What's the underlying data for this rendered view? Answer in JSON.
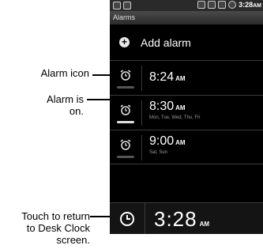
{
  "callouts": {
    "alarm_icon": "Alarm icon",
    "alarm_on_line1": "Alarm is",
    "alarm_on_line2": "on.",
    "touch_line1": "Touch to return",
    "touch_line2": "to Desk Clock",
    "touch_line3": "screen."
  },
  "status_bar": {
    "time": "3:28",
    "ampm": "AM"
  },
  "app": {
    "title": "Alarms"
  },
  "add_alarm": {
    "label": "Add alarm",
    "icon": "add-icon"
  },
  "alarms": [
    {
      "time": "8:24",
      "ampm": "AM",
      "days": "",
      "on": false
    },
    {
      "time": "8:30",
      "ampm": "AM",
      "days": "Mon, Tue, Wed, Thu, Fri",
      "on": true
    },
    {
      "time": "9:00",
      "ampm": "AM",
      "days": "Sat, Sun",
      "on": false
    }
  ],
  "desk_clock": {
    "time": "3:28",
    "ampm": "AM",
    "icon": "clock-icon"
  },
  "colors": {
    "on": "#e0e0e0",
    "off": "#555555",
    "background": "#000000"
  }
}
